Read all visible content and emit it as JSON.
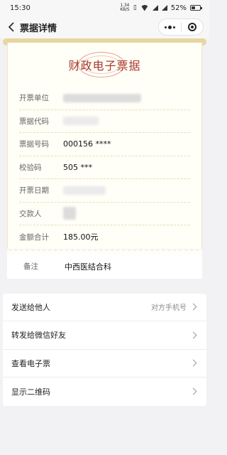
{
  "status": {
    "time": "15:30",
    "net_speed": "1.34",
    "net_unit": "KB/S",
    "battery": "52%",
    "battery_level": 0.52
  },
  "nav": {
    "title": "票据详情",
    "back_icon": "back-icon",
    "more_icon": "more-icon",
    "close_icon": "close-circle-icon"
  },
  "ticket": {
    "title": "财政电子票据",
    "fields": [
      {
        "label": "开票单位",
        "value": ""
      },
      {
        "label": "票据代码",
        "value": ""
      },
      {
        "label": "票据号码",
        "value": "000156 ****"
      },
      {
        "label": "校验码",
        "value": "505 ***"
      },
      {
        "label": "开票日期",
        "value": ""
      },
      {
        "label": "交款人",
        "value": ""
      },
      {
        "label": "金额合计",
        "value": "185.00元"
      }
    ],
    "remark": {
      "label": "备注",
      "value": "中西医结合科"
    }
  },
  "menu": [
    {
      "label": "发送给他人",
      "hint": "对方手机号"
    },
    {
      "label": "转发给微信好友",
      "hint": ""
    },
    {
      "label": "查看电子票",
      "hint": ""
    },
    {
      "label": "显示二维码",
      "hint": ""
    }
  ],
  "colors": {
    "title_red": "#a83a2c",
    "ticket_bg": "#fffef7",
    "page_bg": "#f2f2f4"
  }
}
